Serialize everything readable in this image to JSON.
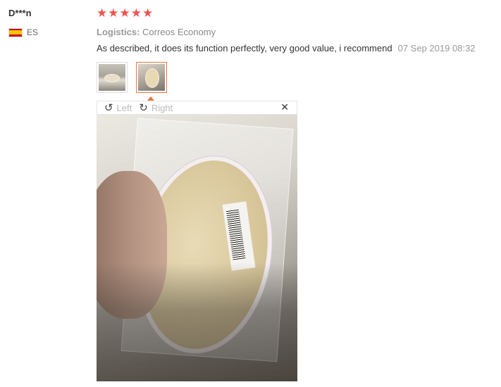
{
  "reviewer": {
    "name": "D***n",
    "country": "ES"
  },
  "review": {
    "rating": 5,
    "stars": [
      "★",
      "★",
      "★",
      "★",
      "★"
    ],
    "logistics_label": "Logistics:",
    "logistics_value": "Correos Economy",
    "text": "As described, it does its function perfectly, very good value, i recommend",
    "date": "07 Sep 2019 08:32"
  },
  "viewer": {
    "rotate_left_label": "Left",
    "rotate_right_label": "Right",
    "close_glyph": "✕"
  },
  "colors": {
    "star": "#f25050",
    "active_border": "#f1733b"
  }
}
